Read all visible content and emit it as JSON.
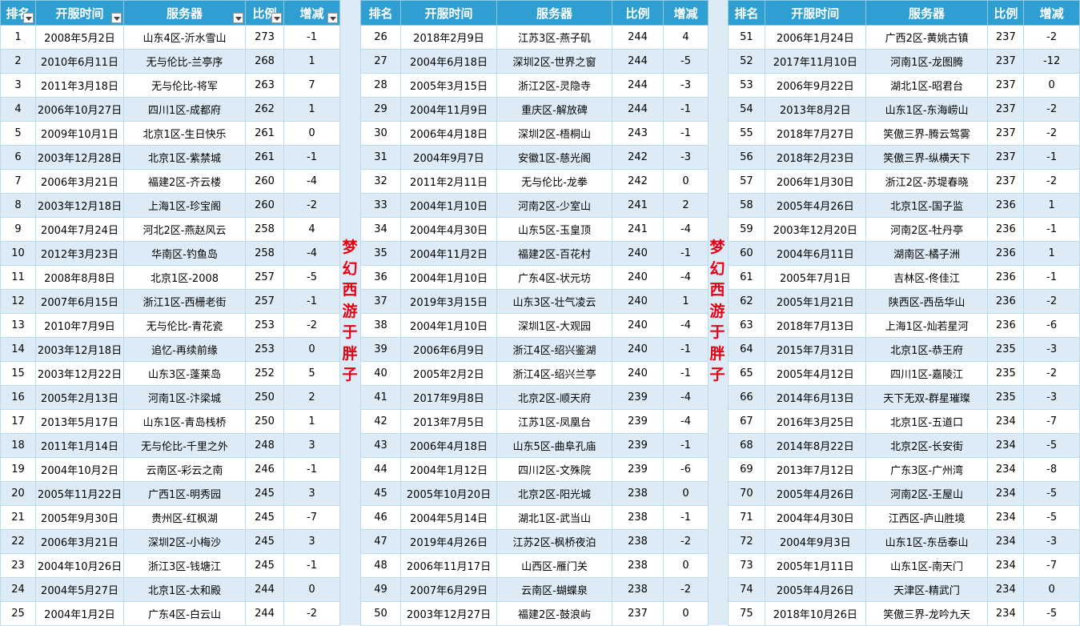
{
  "headers": [
    "排名",
    "开服时间",
    "服务器",
    "比例",
    "增减"
  ],
  "banner_text": "梦幻西游于胖子",
  "panels": [
    {
      "rows": [
        [
          "1",
          "2008年5月2日",
          "山东4区-沂水雪山",
          "273",
          "-1"
        ],
        [
          "2",
          "2010年6月11日",
          "无与伦比-兰亭序",
          "268",
          "1"
        ],
        [
          "3",
          "2011年3月18日",
          "无与伦比-将军",
          "263",
          "7"
        ],
        [
          "4",
          "2006年10月27日",
          "四川1区-成都府",
          "262",
          "1"
        ],
        [
          "5",
          "2009年10月1日",
          "北京1区-生日快乐",
          "261",
          "0"
        ],
        [
          "6",
          "2003年12月28日",
          "北京1区-紫禁城",
          "261",
          "-1"
        ],
        [
          "7",
          "2006年3月21日",
          "福建2区-齐云楼",
          "260",
          "-4"
        ],
        [
          "8",
          "2003年12月18日",
          "上海1区-珍宝阁",
          "260",
          "-2"
        ],
        [
          "9",
          "2004年7月24日",
          "河北2区-燕赵风云",
          "258",
          "4"
        ],
        [
          "10",
          "2012年3月23日",
          "华南区-钓鱼岛",
          "258",
          "-4"
        ],
        [
          "11",
          "2008年8月8日",
          "北京1区-2008",
          "257",
          "-5"
        ],
        [
          "12",
          "2007年6月15日",
          "浙江1区-西栅老街",
          "257",
          "-1"
        ],
        [
          "13",
          "2010年7月9日",
          "无与伦比-青花瓷",
          "253",
          "-2"
        ],
        [
          "14",
          "2003年12月18日",
          "追忆-再续前缘",
          "253",
          "0"
        ],
        [
          "15",
          "2003年12月22日",
          "山东3区-蓬莱岛",
          "252",
          "5"
        ],
        [
          "16",
          "2005年2月13日",
          "河南1区-汴梁城",
          "250",
          "2"
        ],
        [
          "17",
          "2013年5月17日",
          "山东1区-青岛栈桥",
          "250",
          "1"
        ],
        [
          "18",
          "2011年1月14日",
          "无与伦比-千里之外",
          "248",
          "3"
        ],
        [
          "19",
          "2004年10月2日",
          "云南区-彩云之南",
          "246",
          "-1"
        ],
        [
          "20",
          "2005年11月22日",
          "广西1区-明秀园",
          "245",
          "3"
        ],
        [
          "21",
          "2005年9月30日",
          "贵州区-红枫湖",
          "245",
          "-7"
        ],
        [
          "22",
          "2006年3月21日",
          "深圳2区-小梅沙",
          "245",
          "3"
        ],
        [
          "23",
          "2004年10月26日",
          "浙江3区-钱塘江",
          "245",
          "-1"
        ],
        [
          "24",
          "2004年5月27日",
          "北京1区-太和殿",
          "244",
          "0"
        ],
        [
          "25",
          "2004年1月2日",
          "广东4区-白云山",
          "244",
          "-2"
        ]
      ]
    },
    {
      "rows": [
        [
          "26",
          "2018年2月9日",
          "江苏3区-燕子矶",
          "244",
          "4"
        ],
        [
          "27",
          "2004年6月18日",
          "深圳2区-世界之窗",
          "244",
          "-5"
        ],
        [
          "28",
          "2005年3月15日",
          "浙江2区-灵隐寺",
          "244",
          "-3"
        ],
        [
          "29",
          "2004年11月9日",
          "重庆区-解放碑",
          "244",
          "-1"
        ],
        [
          "30",
          "2006年4月18日",
          "深圳2区-梧桐山",
          "243",
          "-1"
        ],
        [
          "31",
          "2004年9月7日",
          "安徽1区-慈光阁",
          "242",
          "-3"
        ],
        [
          "32",
          "2011年2月11日",
          "无与伦比-龙拳",
          "242",
          "0"
        ],
        [
          "33",
          "2004年1月10日",
          "河南2区-少室山",
          "241",
          "2"
        ],
        [
          "34",
          "2004年4月30日",
          "山东5区-玉皇顶",
          "241",
          "-4"
        ],
        [
          "35",
          "2004年11月2日",
          "福建2区-百花村",
          "240",
          "-1"
        ],
        [
          "36",
          "2004年1月10日",
          "广东4区-状元坊",
          "240",
          "-4"
        ],
        [
          "37",
          "2019年3月15日",
          "山东3区-壮气凌云",
          "240",
          "1"
        ],
        [
          "38",
          "2004年1月10日",
          "深圳1区-大观园",
          "240",
          "-4"
        ],
        [
          "39",
          "2006年6月9日",
          "浙江4区-绍兴鉴湖",
          "240",
          "-1"
        ],
        [
          "40",
          "2005年2月2日",
          "浙江4区-绍兴兰亭",
          "240",
          "-1"
        ],
        [
          "41",
          "2017年9月8日",
          "北京2区-顺天府",
          "239",
          "-4"
        ],
        [
          "42",
          "2013年7月5日",
          "江苏1区-凤凰台",
          "239",
          "-4"
        ],
        [
          "43",
          "2006年4月18日",
          "山东5区-曲阜孔庙",
          "239",
          "-1"
        ],
        [
          "44",
          "2004年1月12日",
          "四川2区-文殊院",
          "239",
          "-6"
        ],
        [
          "45",
          "2005年10月20日",
          "北京2区-阳光城",
          "238",
          "0"
        ],
        [
          "46",
          "2004年5月14日",
          "湖北1区-武当山",
          "238",
          "-1"
        ],
        [
          "47",
          "2019年4月26日",
          "江苏2区-枫桥夜泊",
          "238",
          "-2"
        ],
        [
          "48",
          "2006年11月17日",
          "山西区-雁门关",
          "238",
          "0"
        ],
        [
          "49",
          "2007年6月29日",
          "云南区-蝴蝶泉",
          "238",
          "-2"
        ],
        [
          "50",
          "2003年12月27日",
          "福建2区-鼓浪屿",
          "237",
          "0"
        ]
      ]
    },
    {
      "rows": [
        [
          "51",
          "2006年1月24日",
          "广西2区-黄姚古镇",
          "237",
          "-2"
        ],
        [
          "52",
          "2017年11月10日",
          "河南1区-龙图腾",
          "237",
          "-12"
        ],
        [
          "53",
          "2006年9月22日",
          "湖北1区-昭君台",
          "237",
          "0"
        ],
        [
          "54",
          "2013年8月2日",
          "山东1区-东海崂山",
          "237",
          "-2"
        ],
        [
          "55",
          "2018年7月27日",
          "笑傲三界-腾云驾雾",
          "237",
          "-2"
        ],
        [
          "56",
          "2018年2月23日",
          "笑傲三界-纵横天下",
          "237",
          "-1"
        ],
        [
          "57",
          "2006年1月30日",
          "浙江2区-苏堤春晓",
          "237",
          "-2"
        ],
        [
          "58",
          "2005年4月26日",
          "北京1区-国子监",
          "236",
          "1"
        ],
        [
          "59",
          "2003年12月20日",
          "河南2区-牡丹亭",
          "236",
          "-1"
        ],
        [
          "60",
          "2004年6月11日",
          "湖南区-橘子洲",
          "236",
          "1"
        ],
        [
          "61",
          "2005年7月1日",
          "吉林区-佟佳江",
          "236",
          "-1"
        ],
        [
          "62",
          "2005年1月21日",
          "陕西区-西岳华山",
          "236",
          "-2"
        ],
        [
          "63",
          "2018年7月13日",
          "上海1区-灿若星河",
          "236",
          "-6"
        ],
        [
          "64",
          "2015年7月31日",
          "北京1区-恭王府",
          "235",
          "-3"
        ],
        [
          "65",
          "2005年4月12日",
          "四川1区-嘉陵江",
          "235",
          "-2"
        ],
        [
          "66",
          "2014年6月13日",
          "天下无双-群星璀璨",
          "235",
          "-3"
        ],
        [
          "67",
          "2016年3月25日",
          "北京1区-五道口",
          "234",
          "-7"
        ],
        [
          "68",
          "2014年8月22日",
          "北京2区-长安街",
          "234",
          "-5"
        ],
        [
          "69",
          "2013年7月12日",
          "广东3区-广州湾",
          "234",
          "-8"
        ],
        [
          "70",
          "2005年4月26日",
          "河南2区-王屋山",
          "234",
          "-5"
        ],
        [
          "71",
          "2004年4月30日",
          "江西区-庐山胜境",
          "234",
          "-5"
        ],
        [
          "72",
          "2004年9月3日",
          "山东1区-东岳泰山",
          "234",
          "-3"
        ],
        [
          "73",
          "2005年1月11日",
          "山东1区-南天门",
          "234",
          "-7"
        ],
        [
          "74",
          "2005年4月26日",
          "天津区-精武门",
          "234",
          "0"
        ],
        [
          "75",
          "2018年10月26日",
          "笑傲三界-龙吟九天",
          "234",
          "-5"
        ]
      ]
    }
  ]
}
